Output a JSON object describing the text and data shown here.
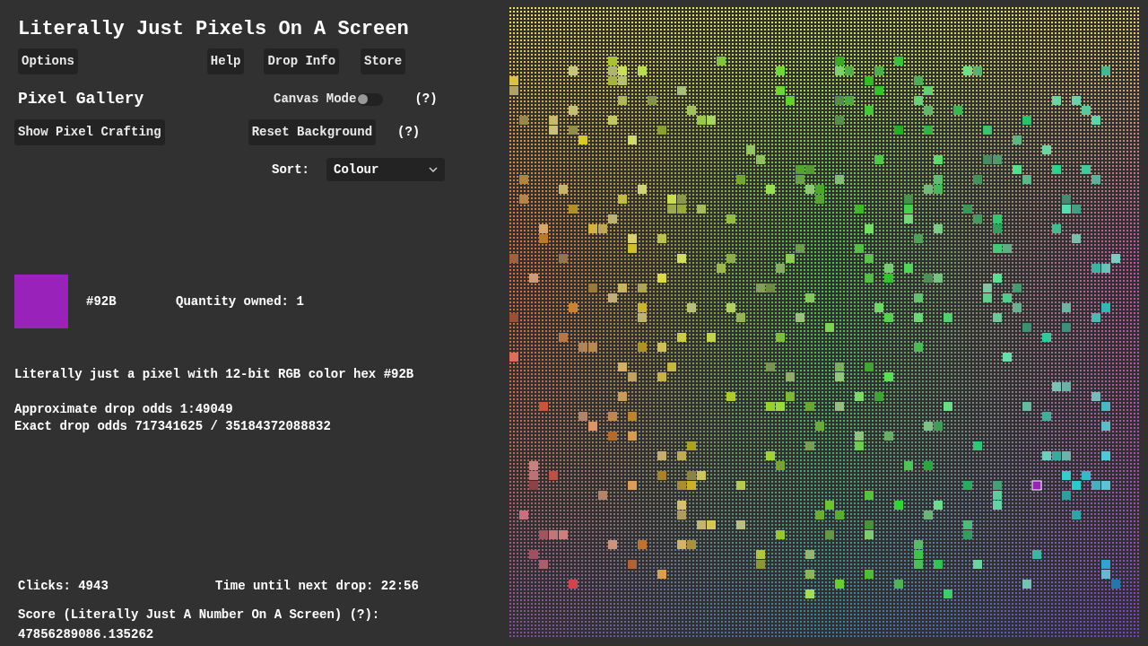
{
  "title": "Literally Just Pixels On A Screen",
  "nav_buttons": [
    "Options",
    "Help",
    "Drop Info",
    "Store"
  ],
  "gallery": {
    "heading": "Pixel Gallery",
    "crafting_button": "Show Pixel Crafting",
    "canvas_mode": {
      "label": "Canvas Mode",
      "on": false,
      "help": "(?)"
    },
    "reset_button": "Reset Background",
    "reset_help": "(?)",
    "sort": {
      "label": "Sort:",
      "value": "Colour"
    }
  },
  "selected_pixel": {
    "color": "#9922bb",
    "hex": "#92B",
    "quantity": "Quantity owned: 1",
    "description": "Literally just a pixel with 12-bit RGB color hex #92B",
    "approx_odds": "Approximate drop odds 1:49049",
    "exact_odds": "Exact drop odds 717341625 / 35184372088832"
  },
  "stats": {
    "clicks": "Clicks: 4943",
    "next_drop": "Time until next drop: 22:56",
    "score_label": "Score (Literally Just A Number On A Screen) (?):",
    "score": "47856289086.135262"
  }
}
